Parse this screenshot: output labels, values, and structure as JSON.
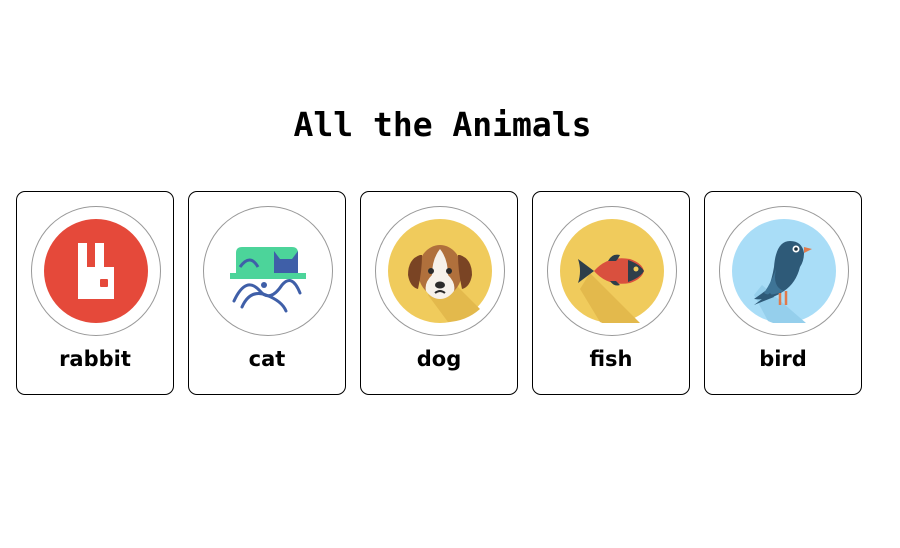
{
  "page": {
    "title": "All the Animals"
  },
  "animals": [
    {
      "label": "rabbit",
      "icon": "rabbit-icon",
      "bg_color": "#E5493A"
    },
    {
      "label": "cat",
      "icon": "cat-icon",
      "bg_color": "#FFFFFF",
      "accent_color": "#4CD49A"
    },
    {
      "label": "dog",
      "icon": "dog-icon",
      "bg_color": "#F0CB5C"
    },
    {
      "label": "fish",
      "icon": "fish-icon",
      "bg_color": "#F0CB5C"
    },
    {
      "label": "bird",
      "icon": "bird-icon",
      "bg_color": "#A9DDF7"
    }
  ]
}
